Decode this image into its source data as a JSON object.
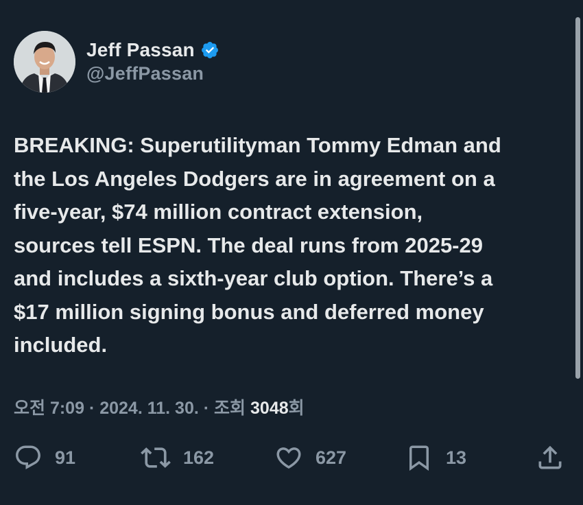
{
  "author": {
    "display_name": "Jeff Passan",
    "handle": "@JeffPassan",
    "verified": true,
    "badge_color": "#1d9bf0"
  },
  "tweet": {
    "lines": [
      "BREAKING: Superutilityman Tommy Edman and",
      "the Los Angeles Dodgers are in agreement on a",
      "five-year, $74 million contract extension,",
      "sources tell ESPN. The deal runs from 2025-29",
      "and includes a sixth-year club option. There’s a",
      "$17 million signing bonus and deferred money",
      "included."
    ]
  },
  "meta": {
    "time": "오전 7:09",
    "sep1": "·",
    "date": "2024. 11. 30.",
    "sep2": "·",
    "views_label": "조회",
    "views_count": "3048",
    "views_suffix": "회"
  },
  "actions": {
    "replies": "91",
    "retweets": "162",
    "likes": "627",
    "bookmarks": "13"
  },
  "colors": {
    "background": "#15202b",
    "text": "#e7e9ea",
    "secondary": "#8b98a5"
  }
}
